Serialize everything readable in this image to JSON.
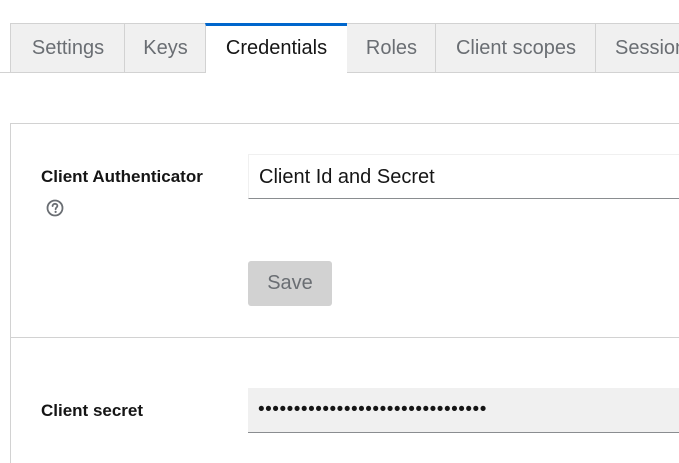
{
  "tabs": [
    {
      "label": "Settings",
      "active": false
    },
    {
      "label": "Keys",
      "active": false
    },
    {
      "label": "Credentials",
      "active": true
    },
    {
      "label": "Roles",
      "active": false
    },
    {
      "label": "Client scopes",
      "active": false
    },
    {
      "label": "Sessions",
      "active": false
    }
  ],
  "authenticator": {
    "label": "Client Authenticator",
    "help_icon": "question-circle-icon",
    "value": "Client Id and Secret",
    "save_label": "Save"
  },
  "secret": {
    "label": "Client secret",
    "value": "••••••••••••••••••••••••••••••••"
  },
  "colors": {
    "accent": "#0066cc",
    "tab_background": "#f0f0f0",
    "border": "#d2d2d2",
    "disabled_button": "#d2d2d2"
  }
}
